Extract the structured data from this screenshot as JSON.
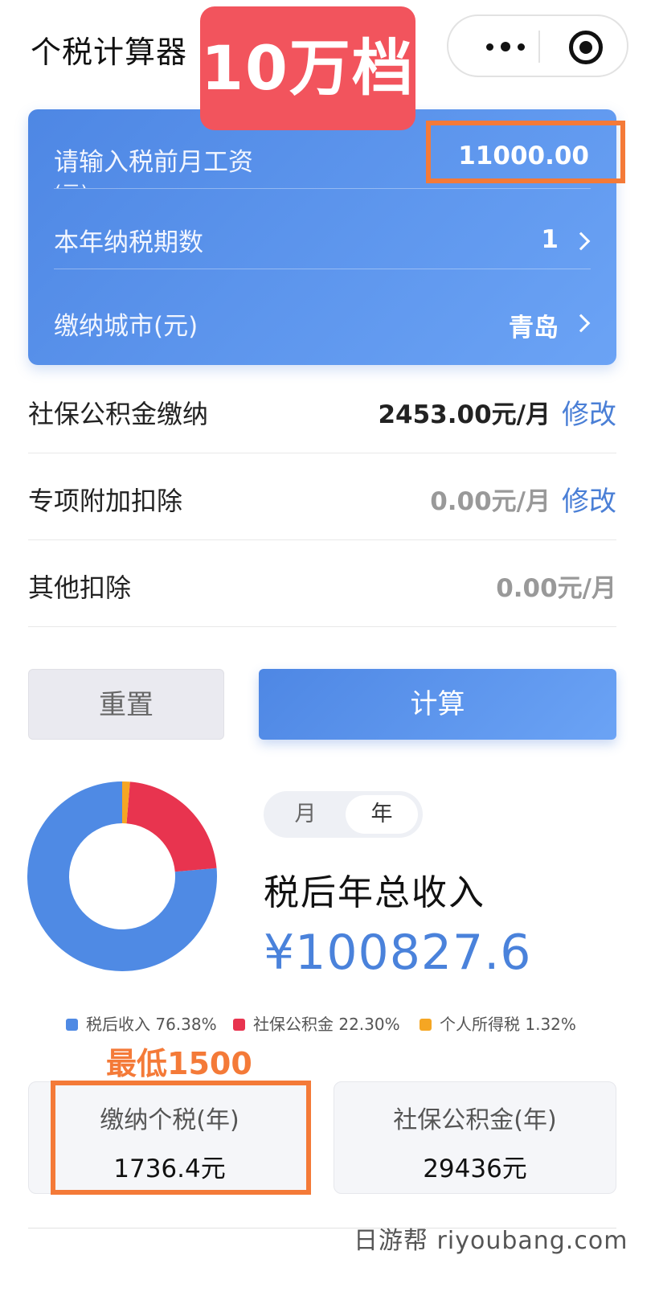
{
  "header": {
    "title": "个税计算器"
  },
  "banner": {
    "text": "10万档"
  },
  "input_card": {
    "salary_label": "请输入税前月工资",
    "salary_label_overflow": "(元)",
    "salary_value": "11000.00",
    "period_label": "本年纳税期数",
    "period_value": "1",
    "city_label": "缴纳城市(元)",
    "city_value": "青岛"
  },
  "deductions": [
    {
      "label": "社保公积金缴纳",
      "amount": "2453.00元/月",
      "action": "修改"
    },
    {
      "label": "专项附加扣除",
      "amount": "0.00元/月",
      "action": "修改"
    },
    {
      "label": "其他扣除",
      "amount": "0.00元/月"
    }
  ],
  "buttons": {
    "reset": "重置",
    "calculate": "计算"
  },
  "result": {
    "toggle": {
      "month": "月",
      "year": "年",
      "selected": "年"
    },
    "label": "税后年总收入",
    "value": "¥100827.6"
  },
  "chart_data": {
    "type": "pie",
    "categories": [
      "税后收入",
      "社保公积金",
      "个人所得税"
    ],
    "values": [
      76.38,
      22.3,
      1.32
    ],
    "value_labels": [
      "76.38%",
      "22.30%",
      "1.32%"
    ],
    "colors": [
      "#4f8ae4",
      "#e8344f",
      "#f5a623"
    ]
  },
  "annotation": {
    "text": "最低1500"
  },
  "summary": [
    {
      "label": "缴纳个税(年)",
      "value": "1736.4元"
    },
    {
      "label": "社保公积金(年)",
      "value": "29436元"
    }
  ],
  "watermark": "日游帮 riyoubang.com",
  "colors": {
    "primary": "#4e87e4",
    "accent_orange": "#f47a38",
    "banner_red": "#f2545d"
  }
}
